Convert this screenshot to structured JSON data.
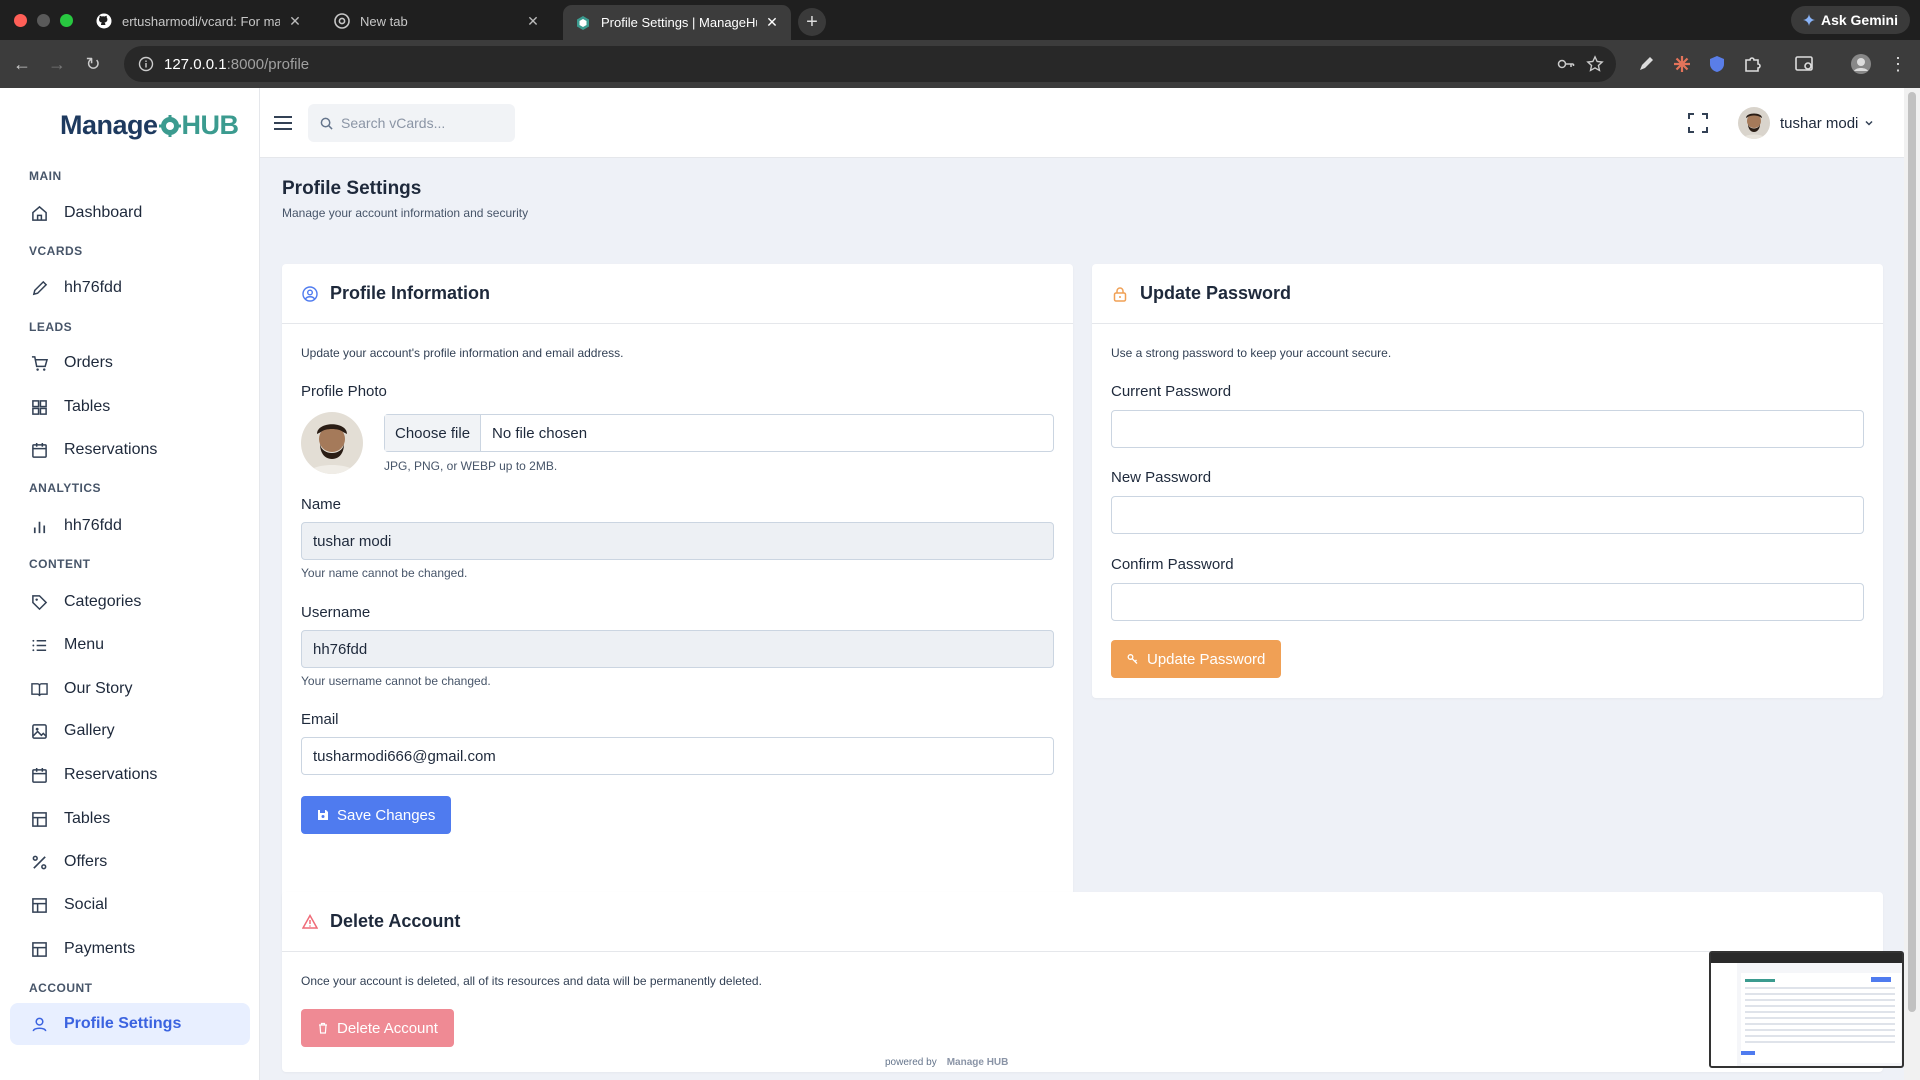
{
  "browser": {
    "tabs": [
      {
        "title": "ertusharmodi/vcard: For man"
      },
      {
        "title": "New tab"
      },
      {
        "title": "Profile Settings | ManageHub"
      }
    ],
    "new_tab_label": "+",
    "url_host": "127.0.0.1",
    "url_path": ":8000/profile",
    "ask_gemini": "Ask Gemini"
  },
  "app": {
    "logo_manage": "Manage",
    "logo_hub": "HUB",
    "search_placeholder": "Search vCards...",
    "user_name": "tushar modi"
  },
  "sidebar": {
    "main_label": "MAIN",
    "dashboard": "Dashboard",
    "vcards_label": "VCARDS",
    "vcard_item": "hh76fdd",
    "leads_label": "LEADS",
    "orders": "Orders",
    "tables_leads": "Tables",
    "reservations_leads": "Reservations",
    "analytics_label": "ANALYTICS",
    "analytics_item": "hh76fdd",
    "content_label": "CONTENT",
    "categories": "Categories",
    "menu": "Menu",
    "our_story": "Our Story",
    "gallery": "Gallery",
    "reservations": "Reservations",
    "tables": "Tables",
    "offers": "Offers",
    "social": "Social",
    "payments": "Payments",
    "account_label": "ACCOUNT",
    "profile_settings": "Profile Settings"
  },
  "page": {
    "title": "Profile Settings",
    "subtitle": "Manage your account information and security"
  },
  "profile_card": {
    "title": "Profile Information",
    "description": "Update your account's profile information and email address.",
    "photo_label": "Profile Photo",
    "choose_file": "Choose file",
    "no_file": "No file chosen",
    "photo_help": "JPG, PNG, or WEBP up to 2MB.",
    "name_label": "Name",
    "name_value": "tushar modi",
    "name_help": "Your name cannot be changed.",
    "username_label": "Username",
    "username_value": "hh76fdd",
    "username_help": "Your username cannot be changed.",
    "email_label": "Email",
    "email_value": "tusharmodi666@gmail.com",
    "save_button": "Save Changes"
  },
  "password_card": {
    "title": "Update Password",
    "description": "Use a strong password to keep your account secure.",
    "current_label": "Current Password",
    "new_label": "New Password",
    "confirm_label": "Confirm Password",
    "update_button": "Update Password"
  },
  "delete_card": {
    "title": "Delete Account",
    "description": "Once your account is deleted, all of its resources and data will be permanently deleted.",
    "delete_button": "Delete Account"
  },
  "footer": {
    "powered_by": "powered by",
    "brand": "Manage HUB"
  },
  "colors": {
    "primary": "#4f7bef",
    "warning": "#f0a055",
    "danger": "#ef8a94",
    "sidebar_active": "#e8efff"
  }
}
